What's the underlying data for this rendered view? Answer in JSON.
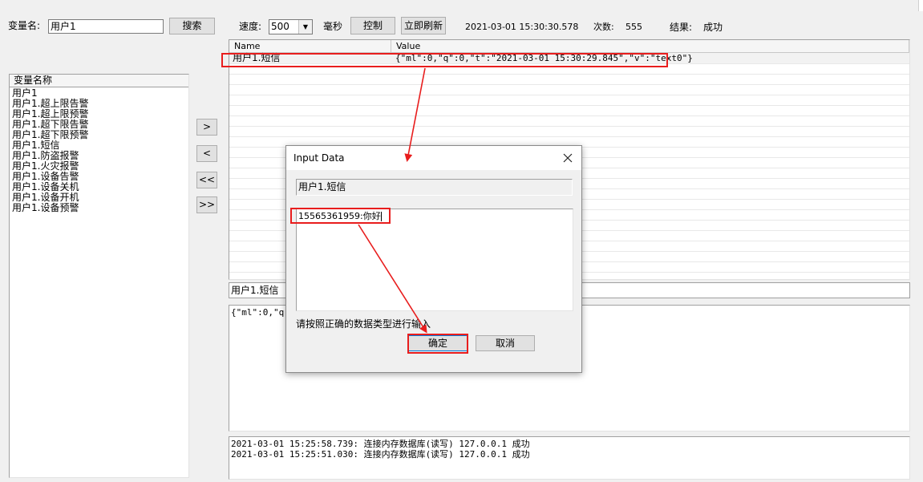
{
  "toolbar": {
    "var_name_label": "变量名:",
    "var_name_value": "用户1",
    "search_label": "搜索",
    "speed_label": "速度:",
    "speed_value": "500",
    "ms_label": "毫秒",
    "control_label": "控制",
    "refresh_label": "立即刷新",
    "timestamp": "2021-03-01 15:30:30.578",
    "count_label": "次数:",
    "count_value": "555",
    "result_label": "结果:",
    "result_value": "成功"
  },
  "var_list": {
    "header": "变量名称",
    "items": [
      "用户1",
      "用户1.超上限告警",
      "用户1.超上限预警",
      "用户1.超下限告警",
      "用户1.超下限预警",
      "用户1.短信",
      "用户1.防盗报警",
      "用户1.火灾报警",
      "用户1.设备告警",
      "用户1.设备关机",
      "用户1.设备开机",
      "用户1.设备预警"
    ]
  },
  "move_buttons": [
    ">",
    "<",
    "<<",
    ">>"
  ],
  "grid": {
    "col_name": "Name",
    "col_value": "Value",
    "rows": [
      {
        "name": "用户1.短信",
        "value": "{\"ml\":0,\"q\":0,\"t\":\"2021-03-01 15:30:29.845\",\"v\":\"text0\"}"
      }
    ]
  },
  "selected_var": "用户1.短信",
  "detail_text": "{\"ml\":0,\"q\"",
  "log": {
    "lines": [
      "2021-03-01 15:25:58.739: 连接内存数据库(读写) 127.0.0.1 成功",
      "2021-03-01 15:25:51.030: 连接内存数据库(读写) 127.0.0.1 成功"
    ]
  },
  "dialog": {
    "title": "Input Data",
    "close_icon": "close-icon",
    "var_name": "用户1.短信",
    "input_value": "15565361959:你好",
    "hint": "请按照正确的数据类型进行输入",
    "ok_label": "确定",
    "cancel_label": "取消"
  },
  "annotation_color": "#e81d1d"
}
